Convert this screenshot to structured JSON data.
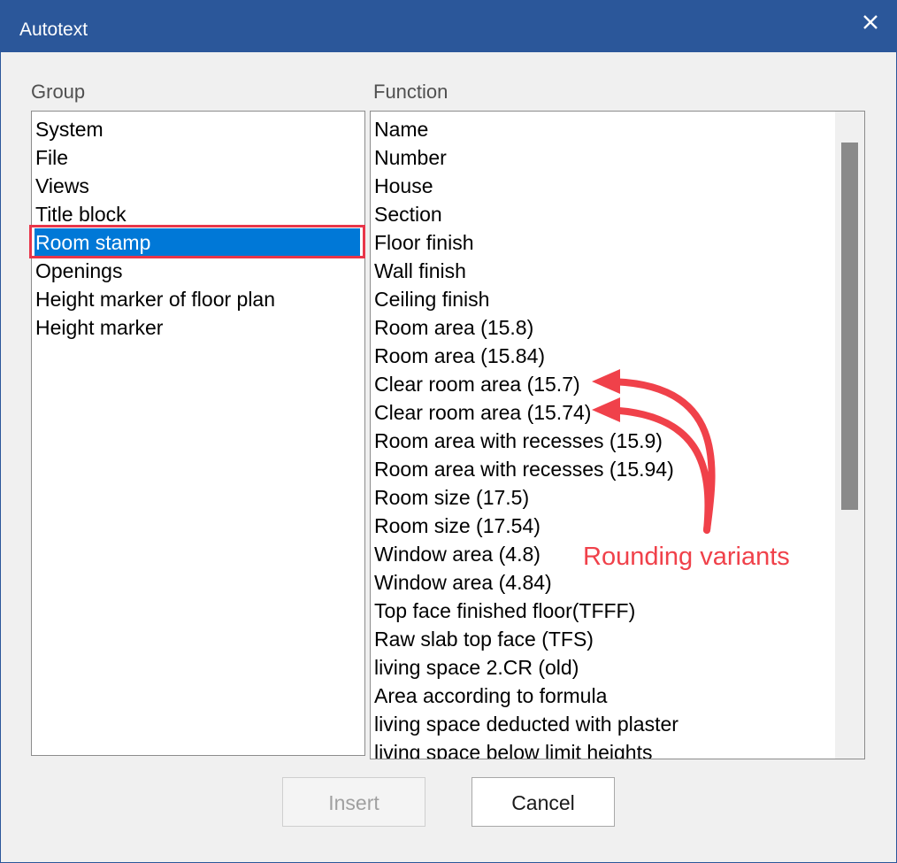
{
  "window": {
    "title": "Autotext",
    "close_icon": "close-icon"
  },
  "group": {
    "label": "Group",
    "items": [
      "System",
      "File",
      "Views",
      "Title block",
      "Room stamp",
      "Openings",
      "Height marker of floor plan",
      "Height marker"
    ],
    "selected_index": 4
  },
  "function": {
    "label": "Function",
    "items": [
      "Name",
      "Number",
      "House",
      "Section",
      "Floor finish",
      "Wall finish",
      "Ceiling finish",
      "Room area (15.8)",
      "Room area (15.84)",
      "Clear room area (15.7)",
      "Clear room area (15.74)",
      "Room area with recesses (15.9)",
      "Room area with recesses (15.94)",
      "Room size (17.5)",
      "Room size (17.54)",
      "Window area (4.8)",
      "Window area (4.84)",
      "Top face finished floor(TFFF)",
      "Raw slab top face (TFS)",
      "living space 2.CR (old)",
      "Area according to formula",
      "living space deducted with plaster",
      "living space below limit heights"
    ]
  },
  "buttons": {
    "insert": "Insert",
    "cancel": "Cancel"
  },
  "annotation": {
    "text": "Rounding variants",
    "color": "#f0414a"
  },
  "colors": {
    "titlebar": "#2b579a",
    "selection": "#0078d7",
    "highlight_border": "#e8364a"
  }
}
